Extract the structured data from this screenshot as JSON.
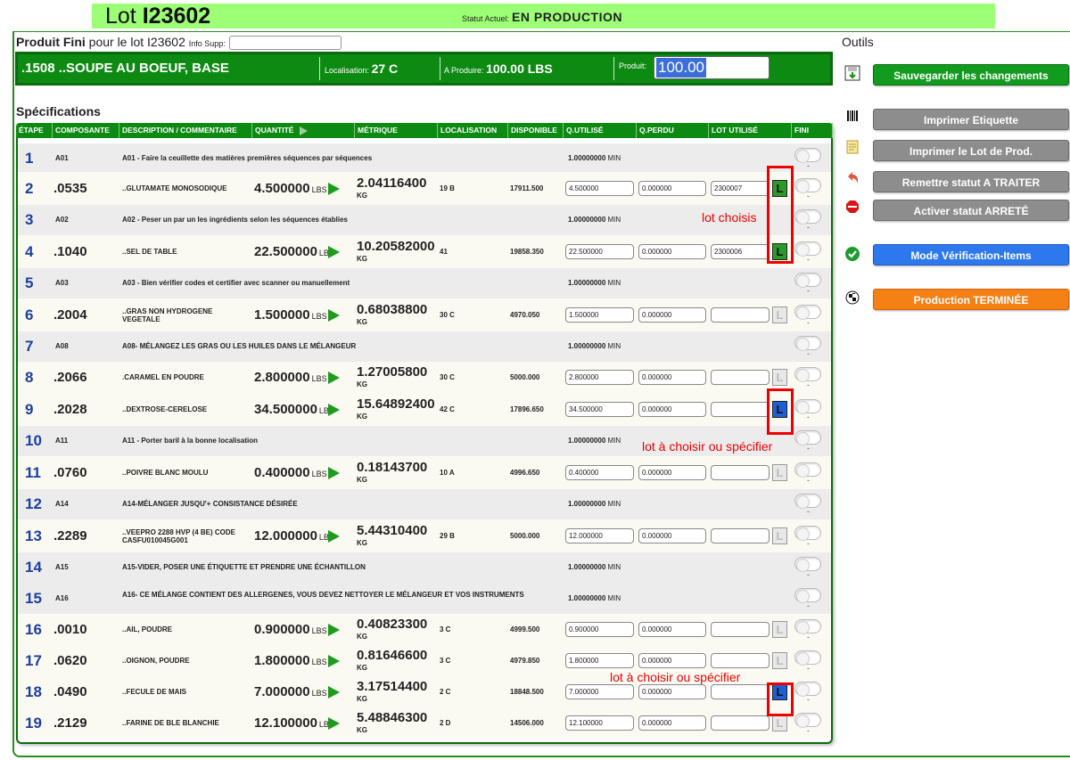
{
  "header": {
    "lot_label": "Lot",
    "lot_number": "I23602",
    "status_label": "Statut Actuel:",
    "status_value": "EN PRODUCTION"
  },
  "product": {
    "title_bold": "Produit Fini",
    "title_rest": "pour le lot I23602",
    "info_label": "Info Supp:",
    "code_name": ".1508 ..SOUPE AU BOEUF, BASE",
    "loc_label": "Localisation:",
    "loc_value": "27 C",
    "produce_label": "A Produire:",
    "produce_value": "100.00 LBS",
    "produit_label": "Produit:",
    "produit_value": "100.00"
  },
  "spec_title": "Spécifications",
  "columns": [
    "ÉTAPE",
    "COMPOSANTE",
    "DESCRIPTION / COMMENTAIRE",
    "QUANTITÉ",
    "MÉTRIQUE",
    "LOCALISATION",
    "DISPONIBLE",
    "Q.UTILISÉ",
    "Q.PERDU",
    "LOT UTILISÉ",
    "FINI"
  ],
  "rows": [
    {
      "n": "1",
      "code": "A01",
      "desc": "A01 - Faire la ceuillette des matières premières séquences par séquences",
      "quse": "1.00000000",
      "unit": "MIN"
    },
    {
      "n": "2",
      "code": ".0535",
      "desc": "..GLUTAMATE MONOSODIQUE",
      "qty": "4.500000",
      "qunit": "LBS",
      "metric": "2.04116400",
      "munit": "KG",
      "loc": "19 B",
      "disp": "17911.500",
      "qu": "4.500000",
      "qp": "0.000000",
      "lot": "2300007",
      "lotbtn": "green"
    },
    {
      "n": "3",
      "code": "A02",
      "desc": "A02 - Peser un par un les ingrédients selon les séquences établies",
      "quse": "1.00000000",
      "unit": "MIN"
    },
    {
      "n": "4",
      "code": ".1040",
      "desc": "..SEL DE TABLE",
      "qty": "22.500000",
      "qunit": "LBS",
      "metric": "10.20582000",
      "munit": "KG",
      "loc": "41",
      "disp": "19858.350",
      "qu": "22.500000",
      "qp": "0.000000",
      "lot": "2300006",
      "lotbtn": "green"
    },
    {
      "n": "5",
      "code": "A03",
      "desc": "A03 - Bien vérifier codes et certifier avec scanner ou manuellement",
      "quse": "1.00000000",
      "unit": "MIN"
    },
    {
      "n": "6",
      "code": ".2004",
      "desc": "..GRAS NON HYDROGENE VEGETALE",
      "qty": "1.500000",
      "qunit": "LBS",
      "metric": "0.68038800",
      "munit": "KG",
      "loc": "30 C",
      "disp": "4970.050",
      "qu": "1.500000",
      "qp": "0.000000",
      "lot": "",
      "lotbtn": "grey"
    },
    {
      "n": "7",
      "code": "A08",
      "desc": "A08- MÉLANGEZ LES GRAS OU LES HUILES DANS LE MÉLANGEUR",
      "quse": "1.00000000",
      "unit": "MIN"
    },
    {
      "n": "8",
      "code": ".2066",
      "desc": ".CARAMEL EN POUDRE",
      "qty": "2.800000",
      "qunit": "LBS",
      "metric": "1.27005800",
      "munit": "KG",
      "loc": "30 C",
      "disp": "5000.000",
      "qu": "2.800000",
      "qp": "0.000000",
      "lot": "",
      "lotbtn": "grey"
    },
    {
      "n": "9",
      "code": ".2028",
      "desc": "..DEXTROSE-CERELOSE",
      "qty": "34.500000",
      "qunit": "LBS",
      "metric": "15.64892400",
      "munit": "KG",
      "loc": "42 C",
      "disp": "17896.650",
      "qu": "34.500000",
      "qp": "0.000000",
      "lot": "",
      "lotbtn": "blue"
    },
    {
      "n": "10",
      "code": "A11",
      "desc": "A11 - Porter baril à la bonne localisation",
      "quse": "1.00000000",
      "unit": "MIN"
    },
    {
      "n": "11",
      "code": ".0760",
      "desc": "..POIVRE BLANC MOULU",
      "qty": "0.400000",
      "qunit": "LBS",
      "metric": "0.18143700",
      "munit": "KG",
      "loc": "10 A",
      "disp": "4996.650",
      "qu": "0.400000",
      "qp": "0.000000",
      "lot": "",
      "lotbtn": "grey"
    },
    {
      "n": "12",
      "code": "A14",
      "desc": "A14-MÉLANGER JUSQU'+ CONSISTANCE DÉSIRÉE",
      "quse": "1.00000000",
      "unit": "MIN"
    },
    {
      "n": "13",
      "code": ".2289",
      "desc": "..VEEPRO 2288 HVP (4 BE) CODE CASFU010045G001",
      "qty": "12.000000",
      "qunit": "LBS",
      "metric": "5.44310400",
      "munit": "KG",
      "loc": "29 B",
      "disp": "5000.000",
      "qu": "12.000000",
      "qp": "0.000000",
      "lot": "",
      "lotbtn": "grey"
    },
    {
      "n": "14",
      "code": "A15",
      "desc": "A15-VIDER, POSER UNE ÉTIQUETTE ET PRENDRE UNE ÉCHANTILLON",
      "quse": "1.00000000",
      "unit": "MIN"
    },
    {
      "n": "15",
      "code": "A16",
      "desc": "A16- CE MÉLANGE CONTIENT DES ALLERGENES, VOUS DEVEZ NETTOYER LE MÉLANGEUR ET VOS INSTRUMENTS",
      "quse": "1.00000000",
      "unit": "MIN"
    },
    {
      "n": "16",
      "code": ".0010",
      "desc": "..AIL, POUDRE",
      "qty": "0.900000",
      "qunit": "LBS",
      "metric": "0.40823300",
      "munit": "KG",
      "loc": "3 C",
      "disp": "4999.500",
      "qu": "0.900000",
      "qp": "0.000000",
      "lot": "",
      "lotbtn": "grey"
    },
    {
      "n": "17",
      "code": ".0620",
      "desc": "..OIGNON, POUDRE",
      "qty": "1.800000",
      "qunit": "LBS",
      "metric": "0.81646600",
      "munit": "KG",
      "loc": "3 C",
      "disp": "4979.850",
      "qu": "1.800000",
      "qp": "0.000000",
      "lot": "",
      "lotbtn": "grey"
    },
    {
      "n": "18",
      "code": ".0490",
      "desc": "..FECULE DE MAIS",
      "qty": "7.000000",
      "qunit": "LBS",
      "metric": "3.17514400",
      "munit": "KG",
      "loc": "2 C",
      "disp": "18848.500",
      "qu": "7.000000",
      "qp": "0.000000",
      "lot": "",
      "lotbtn": "blue"
    },
    {
      "n": "19",
      "code": ".2129",
      "desc": "..FARINE DE BLE BLANCHIE",
      "qty": "12.100000",
      "qunit": "LBS",
      "metric": "5.48846300",
      "munit": "KG",
      "loc": "2 D",
      "disp": "14506.000",
      "qu": "12.100000",
      "qp": "0.000000",
      "lot": "",
      "lotbtn": "grey"
    }
  ],
  "annotations": {
    "lot_choisis": "lot choisis",
    "lot_a_choisir_1": "lot à choisir ou spécifier",
    "lot_a_choisir_2": "lot à choisir ou spécifier"
  },
  "tools": {
    "title": "Outils",
    "save": "Sauvegarder les changements",
    "print_label": "Imprimer Etiquette",
    "print_lot": "Imprimer le Lot de Prod.",
    "reset_status": "Remettre statut A TRAITER",
    "stop_status": "Activer statut ARRETÉ",
    "verify_mode": "Mode Vérification-Items",
    "finish": "Production TERMINÉE"
  },
  "colors": {
    "header_bar": "#9cff75",
    "table_green": "#0d8a12",
    "accent_red": "#e00000"
  }
}
